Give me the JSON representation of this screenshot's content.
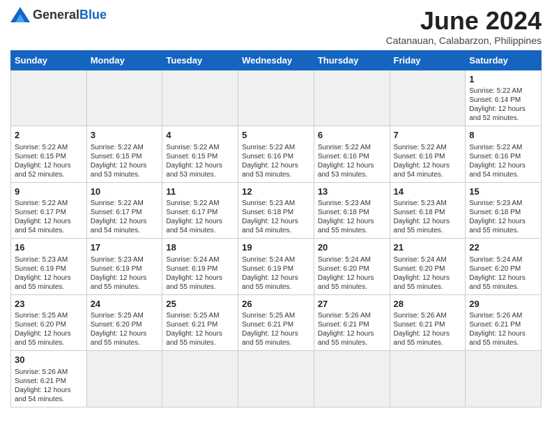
{
  "header": {
    "logo_general": "General",
    "logo_blue": "Blue",
    "month_title": "June 2024",
    "subtitle": "Catanauan, Calabarzon, Philippines"
  },
  "weekdays": [
    "Sunday",
    "Monday",
    "Tuesday",
    "Wednesday",
    "Thursday",
    "Friday",
    "Saturday"
  ],
  "weeks": [
    [
      {
        "day": "",
        "info": ""
      },
      {
        "day": "",
        "info": ""
      },
      {
        "day": "",
        "info": ""
      },
      {
        "day": "",
        "info": ""
      },
      {
        "day": "",
        "info": ""
      },
      {
        "day": "",
        "info": ""
      },
      {
        "day": "1",
        "info": "Sunrise: 5:22 AM\nSunset: 6:14 PM\nDaylight: 12 hours\nand 52 minutes."
      }
    ],
    [
      {
        "day": "2",
        "info": "Sunrise: 5:22 AM\nSunset: 6:15 PM\nDaylight: 12 hours\nand 52 minutes."
      },
      {
        "day": "3",
        "info": "Sunrise: 5:22 AM\nSunset: 6:15 PM\nDaylight: 12 hours\nand 53 minutes."
      },
      {
        "day": "4",
        "info": "Sunrise: 5:22 AM\nSunset: 6:15 PM\nDaylight: 12 hours\nand 53 minutes."
      },
      {
        "day": "5",
        "info": "Sunrise: 5:22 AM\nSunset: 6:16 PM\nDaylight: 12 hours\nand 53 minutes."
      },
      {
        "day": "6",
        "info": "Sunrise: 5:22 AM\nSunset: 6:16 PM\nDaylight: 12 hours\nand 53 minutes."
      },
      {
        "day": "7",
        "info": "Sunrise: 5:22 AM\nSunset: 6:16 PM\nDaylight: 12 hours\nand 54 minutes."
      },
      {
        "day": "8",
        "info": "Sunrise: 5:22 AM\nSunset: 6:16 PM\nDaylight: 12 hours\nand 54 minutes."
      }
    ],
    [
      {
        "day": "9",
        "info": "Sunrise: 5:22 AM\nSunset: 6:17 PM\nDaylight: 12 hours\nand 54 minutes."
      },
      {
        "day": "10",
        "info": "Sunrise: 5:22 AM\nSunset: 6:17 PM\nDaylight: 12 hours\nand 54 minutes."
      },
      {
        "day": "11",
        "info": "Sunrise: 5:22 AM\nSunset: 6:17 PM\nDaylight: 12 hours\nand 54 minutes."
      },
      {
        "day": "12",
        "info": "Sunrise: 5:23 AM\nSunset: 6:18 PM\nDaylight: 12 hours\nand 54 minutes."
      },
      {
        "day": "13",
        "info": "Sunrise: 5:23 AM\nSunset: 6:18 PM\nDaylight: 12 hours\nand 55 minutes."
      },
      {
        "day": "14",
        "info": "Sunrise: 5:23 AM\nSunset: 6:18 PM\nDaylight: 12 hours\nand 55 minutes."
      },
      {
        "day": "15",
        "info": "Sunrise: 5:23 AM\nSunset: 6:18 PM\nDaylight: 12 hours\nand 55 minutes."
      }
    ],
    [
      {
        "day": "16",
        "info": "Sunrise: 5:23 AM\nSunset: 6:19 PM\nDaylight: 12 hours\nand 55 minutes."
      },
      {
        "day": "17",
        "info": "Sunrise: 5:23 AM\nSunset: 6:19 PM\nDaylight: 12 hours\nand 55 minutes."
      },
      {
        "day": "18",
        "info": "Sunrise: 5:24 AM\nSunset: 6:19 PM\nDaylight: 12 hours\nand 55 minutes."
      },
      {
        "day": "19",
        "info": "Sunrise: 5:24 AM\nSunset: 6:19 PM\nDaylight: 12 hours\nand 55 minutes."
      },
      {
        "day": "20",
        "info": "Sunrise: 5:24 AM\nSunset: 6:20 PM\nDaylight: 12 hours\nand 55 minutes."
      },
      {
        "day": "21",
        "info": "Sunrise: 5:24 AM\nSunset: 6:20 PM\nDaylight: 12 hours\nand 55 minutes."
      },
      {
        "day": "22",
        "info": "Sunrise: 5:24 AM\nSunset: 6:20 PM\nDaylight: 12 hours\nand 55 minutes."
      }
    ],
    [
      {
        "day": "23",
        "info": "Sunrise: 5:25 AM\nSunset: 6:20 PM\nDaylight: 12 hours\nand 55 minutes."
      },
      {
        "day": "24",
        "info": "Sunrise: 5:25 AM\nSunset: 6:20 PM\nDaylight: 12 hours\nand 55 minutes."
      },
      {
        "day": "25",
        "info": "Sunrise: 5:25 AM\nSunset: 6:21 PM\nDaylight: 12 hours\nand 55 minutes."
      },
      {
        "day": "26",
        "info": "Sunrise: 5:25 AM\nSunset: 6:21 PM\nDaylight: 12 hours\nand 55 minutes."
      },
      {
        "day": "27",
        "info": "Sunrise: 5:26 AM\nSunset: 6:21 PM\nDaylight: 12 hours\nand 55 minutes."
      },
      {
        "day": "28",
        "info": "Sunrise: 5:26 AM\nSunset: 6:21 PM\nDaylight: 12 hours\nand 55 minutes."
      },
      {
        "day": "29",
        "info": "Sunrise: 5:26 AM\nSunset: 6:21 PM\nDaylight: 12 hours\nand 55 minutes."
      }
    ],
    [
      {
        "day": "30",
        "info": "Sunrise: 5:26 AM\nSunset: 6:21 PM\nDaylight: 12 hours\nand 54 minutes."
      },
      {
        "day": "",
        "info": ""
      },
      {
        "day": "",
        "info": ""
      },
      {
        "day": "",
        "info": ""
      },
      {
        "day": "",
        "info": ""
      },
      {
        "day": "",
        "info": ""
      },
      {
        "day": "",
        "info": ""
      }
    ]
  ],
  "empty_first_row_days": [
    0,
    1,
    2,
    3,
    4,
    5
  ],
  "empty_last_row_days": [
    1,
    2,
    3,
    4,
    5,
    6
  ]
}
